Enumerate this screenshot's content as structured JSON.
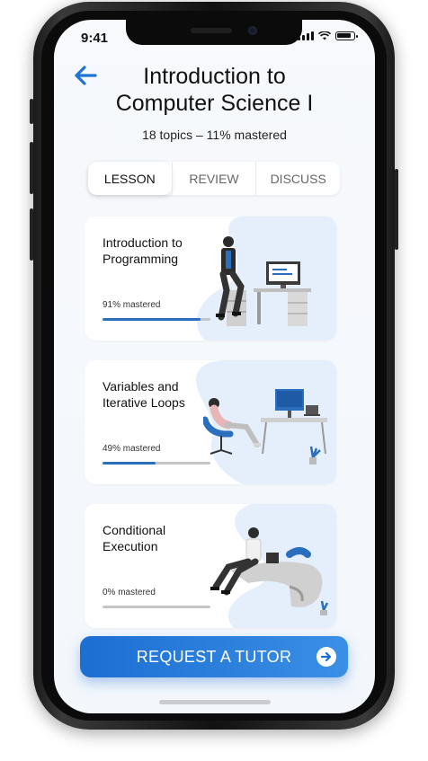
{
  "status_bar": {
    "time": "9:41"
  },
  "header": {
    "back_icon": "arrow-left-icon",
    "title_line1": "Introduction to",
    "title_line2": "Computer Science I",
    "subtitle": "18 topics – 11% mastered"
  },
  "tabs": [
    {
      "label": "LESSON",
      "active": true
    },
    {
      "label": "REVIEW",
      "active": false
    },
    {
      "label": "DISCUSS",
      "active": false
    }
  ],
  "lessons": [
    {
      "title": "Introduction to Programming",
      "progress_label": "91% mastered",
      "progress": 0.91,
      "illustration": "person-sitting-on-desk-with-computer"
    },
    {
      "title": "Variables and Iterative Loops",
      "progress_label": "49% mastered",
      "progress": 0.49,
      "illustration": "person-reclining-in-chair-at-desk"
    },
    {
      "title": "Conditional Execution",
      "progress_label": "0% mastered",
      "progress": 0.0,
      "illustration": "person-seated-at-curved-desk"
    }
  ],
  "cta": {
    "label": "REQUEST A TUTOR",
    "icon": "arrow-right-circle-icon"
  },
  "colors": {
    "accent": "#2a6ebd",
    "card_blob": "#e4effb",
    "cta_start": "#1c6fd2",
    "cta_end": "#3a8fe6"
  }
}
